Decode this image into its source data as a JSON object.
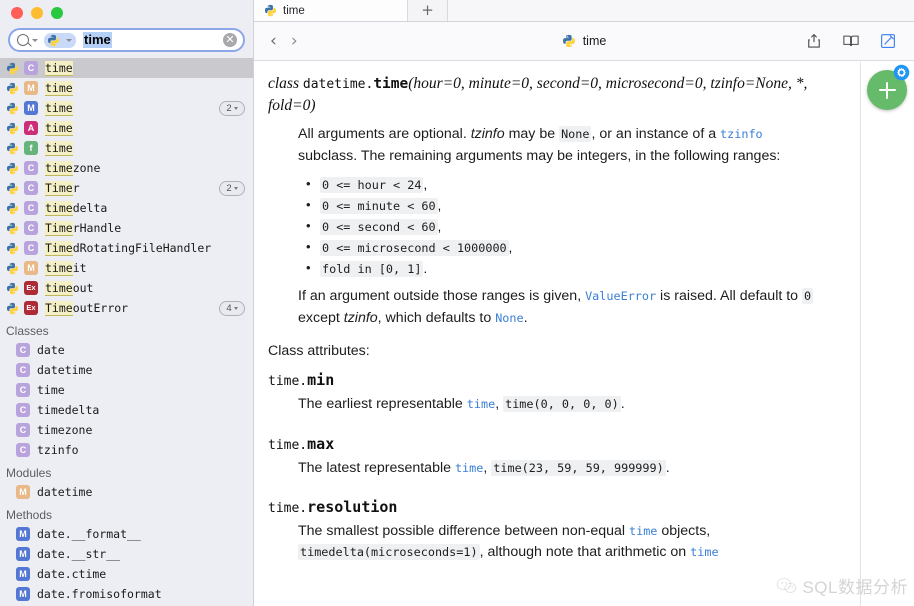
{
  "window": {
    "traffic_lights": [
      "close",
      "minimize",
      "maximize"
    ]
  },
  "search": {
    "value": "time",
    "scope_chip": "python",
    "clear_label": "✕",
    "placeholder": "Search"
  },
  "sidebar": {
    "results": [
      {
        "label": "time",
        "highlight": "time",
        "rest": "",
        "kind": "Class",
        "badge": "C",
        "badge_class": "b-class",
        "selected": true,
        "count": ""
      },
      {
        "label": "time",
        "highlight": "time",
        "rest": "",
        "kind": "Module",
        "badge": "M",
        "badge_class": "b-module",
        "selected": false,
        "count": ""
      },
      {
        "label": "time",
        "highlight": "time",
        "rest": "",
        "kind": "Method",
        "badge": "M",
        "badge_class": "b-method",
        "selected": false,
        "count": "2"
      },
      {
        "label": "time",
        "highlight": "time",
        "rest": "",
        "kind": "Attribute",
        "badge": "A",
        "badge_class": "b-attr",
        "selected": false,
        "count": ""
      },
      {
        "label": "time",
        "highlight": "time",
        "rest": "",
        "kind": "Function",
        "badge": "f",
        "badge_class": "b-func",
        "selected": false,
        "count": ""
      },
      {
        "label": "timezone",
        "highlight": "time",
        "rest": "zone",
        "kind": "Class",
        "badge": "C",
        "badge_class": "b-class",
        "selected": false,
        "count": ""
      },
      {
        "label": "Timer",
        "highlight": "Time",
        "rest": "r",
        "kind": "Class",
        "badge": "C",
        "badge_class": "b-class",
        "selected": false,
        "count": "2"
      },
      {
        "label": "timedelta",
        "highlight": "time",
        "rest": "delta",
        "kind": "Class",
        "badge": "C",
        "badge_class": "b-class",
        "selected": false,
        "count": ""
      },
      {
        "label": "TimerHandle",
        "highlight": "Time",
        "rest": "rHandle",
        "kind": "Class",
        "badge": "C",
        "badge_class": "b-class",
        "selected": false,
        "count": ""
      },
      {
        "label": "TimedRotatingFileHandler",
        "highlight": "Time",
        "rest": "dRotatingFileHandler",
        "kind": "Class",
        "badge": "C",
        "badge_class": "b-class",
        "selected": false,
        "count": ""
      },
      {
        "label": "timeit",
        "highlight": "time",
        "rest": "it",
        "kind": "Module",
        "badge": "M",
        "badge_class": "b-module",
        "selected": false,
        "count": ""
      },
      {
        "label": "timeout",
        "highlight": "time",
        "rest": "out",
        "kind": "Exception",
        "badge": "Ex",
        "badge_class": "b-ex",
        "selected": false,
        "count": ""
      },
      {
        "label": "TimeoutError",
        "highlight": "Time",
        "rest": "outError",
        "kind": "Exception",
        "badge": "Ex",
        "badge_class": "b-ex",
        "selected": false,
        "count": "4"
      }
    ],
    "groups": [
      {
        "title": "Classes",
        "items": [
          {
            "label": "date",
            "badge": "C",
            "badge_class": "b-class"
          },
          {
            "label": "datetime",
            "badge": "C",
            "badge_class": "b-class"
          },
          {
            "label": "time",
            "badge": "C",
            "badge_class": "b-class"
          },
          {
            "label": "timedelta",
            "badge": "C",
            "badge_class": "b-class"
          },
          {
            "label": "timezone",
            "badge": "C",
            "badge_class": "b-class"
          },
          {
            "label": "tzinfo",
            "badge": "C",
            "badge_class": "b-class"
          }
        ]
      },
      {
        "title": "Modules",
        "items": [
          {
            "label": "datetime",
            "badge": "M",
            "badge_class": "b-module"
          }
        ]
      },
      {
        "title": "Methods",
        "items": [
          {
            "label": "date.__format__",
            "badge": "M",
            "badge_class": "b-method"
          },
          {
            "label": "date.__str__",
            "badge": "M",
            "badge_class": "b-method"
          },
          {
            "label": "date.ctime",
            "badge": "M",
            "badge_class": "b-method"
          },
          {
            "label": "date.fromisoformat",
            "badge": "M",
            "badge_class": "b-method"
          }
        ]
      }
    ]
  },
  "tabs": {
    "open": [
      {
        "title": "time",
        "icon": "python-icon",
        "active": true
      }
    ],
    "new_tab_label": "+"
  },
  "toolbar": {
    "back_label": "‹",
    "forward_label": "›",
    "doc_title": "time",
    "icons": [
      "share-icon",
      "bookmarks-icon",
      "annotate-icon"
    ]
  },
  "doc": {
    "signature": {
      "class_kw": "class",
      "module": "datetime.",
      "name": "time",
      "args_line1": "(hour=0, minute=0, second=0, microsecond=0,",
      "args_line2": "tzinfo=None, *, fold=0)"
    },
    "intro": {
      "p1_a": "All arguments are optional. ",
      "p1_tzinfo": "tzinfo",
      "p1_b": " may be ",
      "p1_none": "None",
      "p1_c": ", or an instance of a ",
      "p1_link": "tzinfo",
      "p1_d": " subclass. The remaining arguments may be integers, in the following ranges:"
    },
    "ranges": [
      {
        "code": "0 <= hour < 24",
        "tail": ","
      },
      {
        "code": "0 <= minute < 60",
        "tail": ","
      },
      {
        "code": "0 <= second < 60",
        "tail": ","
      },
      {
        "code": "0 <= microsecond < 1000000",
        "tail": ","
      },
      {
        "code": "fold in [0, 1]",
        "tail": "."
      }
    ],
    "after_ranges": {
      "a": "If an argument outside those ranges is given, ",
      "err": "ValueError",
      "b": " is raised. All default to ",
      "zero": "0",
      "c": " except ",
      "tzinfo": "tzinfo",
      "d": ", which defaults to ",
      "none": "None",
      "e": "."
    },
    "class_attributes_heading": "Class attributes:",
    "attributes": [
      {
        "prefix": "time.",
        "name": "min",
        "desc_a": "The earliest representable ",
        "desc_link": "time",
        "desc_b": ", ",
        "desc_code": "time(0, 0, 0, 0)",
        "desc_c": "."
      },
      {
        "prefix": "time.",
        "name": "max",
        "desc_a": "The latest representable ",
        "desc_link": "time",
        "desc_b": ", ",
        "desc_code": "time(23, 59, 59, 999999)",
        "desc_c": "."
      },
      {
        "prefix": "time.",
        "name": "resolution",
        "desc_a": "The smallest possible difference between non-equal ",
        "desc_link": "time",
        "desc_b": " objects, ",
        "desc_code": "timedelta(microseconds=1)",
        "desc_c": ", although note that arithmetic on ",
        "desc_link2": "time"
      }
    ]
  },
  "fab": {
    "plus_label": "+",
    "badge_icon": "gear-icon",
    "color": "#66bb6a",
    "badge_color": "#2196f3"
  },
  "watermark": {
    "text": "SQL数据分析",
    "icon": "wechat-icon"
  }
}
